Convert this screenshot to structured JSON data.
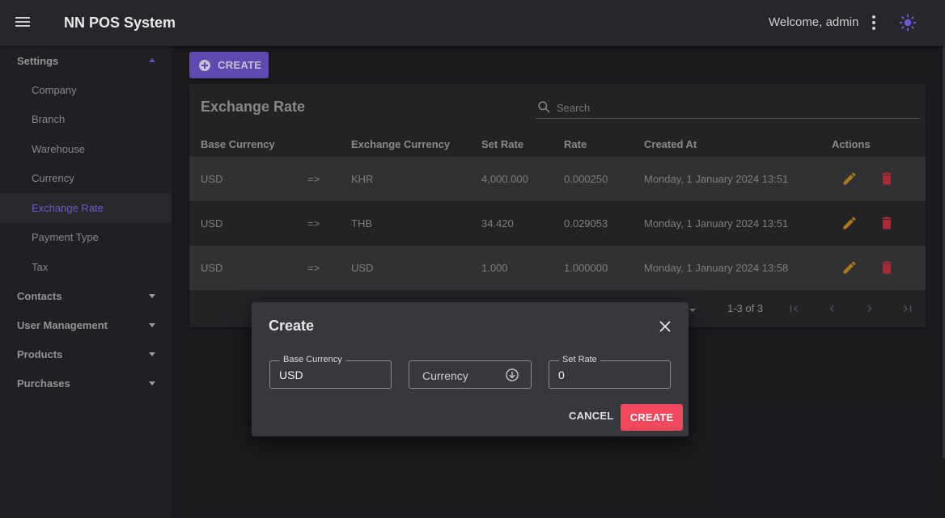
{
  "topbar": {
    "title": "NN POS System",
    "welcome": "Welcome, admin"
  },
  "sidebar": {
    "settings_label": "Settings",
    "settings_items": [
      "Company",
      "Branch",
      "Warehouse",
      "Currency",
      "Exchange Rate",
      "Payment Type",
      "Tax"
    ],
    "active_item": "Exchange Rate",
    "groups": [
      "Contacts",
      "User Management",
      "Products",
      "Purchases"
    ]
  },
  "toolbar": {
    "create_label": "CREATE"
  },
  "table": {
    "title": "Exchange Rate",
    "search_placeholder": "Search",
    "headers": [
      "Base Currency",
      "Exchange Currency",
      "Set Rate",
      "Rate",
      "Created At",
      "Actions"
    ],
    "rows": [
      {
        "base": "USD",
        "arrow": "=>",
        "exchange": "KHR",
        "set_rate": "4,000.000",
        "rate": "0.000250",
        "created_at": "Monday, 1 January 2024 13:51"
      },
      {
        "base": "USD",
        "arrow": "=>",
        "exchange": "THB",
        "set_rate": "34.420",
        "rate": "0.029053",
        "created_at": "Monday, 1 January 2024 13:51"
      },
      {
        "base": "USD",
        "arrow": "=>",
        "exchange": "USD",
        "set_rate": "1.000",
        "rate": "1.000000",
        "created_at": "Monday, 1 January 2024 13:58"
      }
    ],
    "pagination": "1-3 of 3"
  },
  "dialog": {
    "title": "Create",
    "base_currency_label": "Base Currency",
    "base_currency_value": "USD",
    "currency_placeholder": "Currency",
    "set_rate_label": "Set Rate",
    "set_rate_value": "0",
    "cancel_label": "CANCEL",
    "create_label": "CREATE"
  },
  "colors": {
    "accent": "#6b55c6",
    "danger": "#f2485e",
    "edit": "#c08a1e",
    "delete": "#c0303f"
  }
}
